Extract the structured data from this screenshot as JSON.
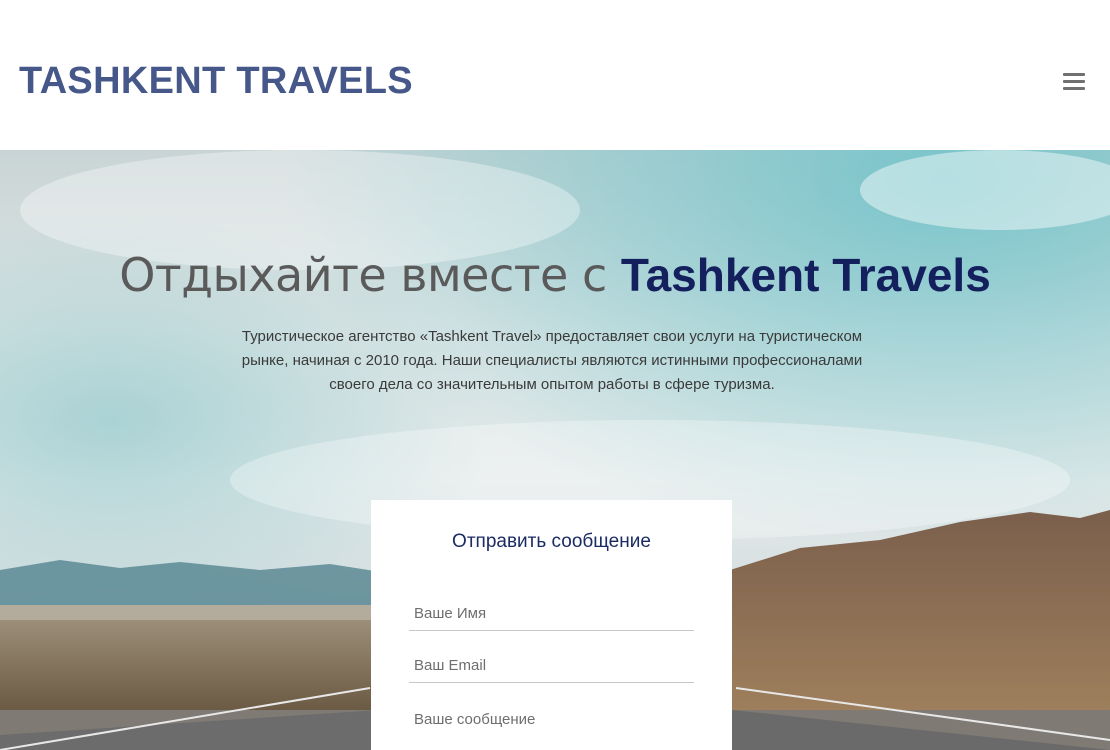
{
  "header": {
    "logo": "TASHKENT TRAVELS",
    "menu_icon": "hamburger-menu-icon"
  },
  "hero": {
    "title_prefix": "Отдыхайте вместе с ",
    "title_brand": "Tashkent Travels",
    "description": "Туристическое агентство «Tashkent Travel» предоставляет свои услуги на туристическом рынке, начиная с 2010 года. Наши специалисты являются истинными профессионалами своего дела со значительным опытом работы в сфере туризма."
  },
  "contact_form": {
    "title": "Отправить сообщение",
    "name_placeholder": "Ваше Имя",
    "email_placeholder": "Ваш Email",
    "message_placeholder": "Ваше сообщение"
  },
  "colors": {
    "logo": "#465889",
    "brand_accent": "#14205e",
    "form_title": "#1b2b63"
  }
}
